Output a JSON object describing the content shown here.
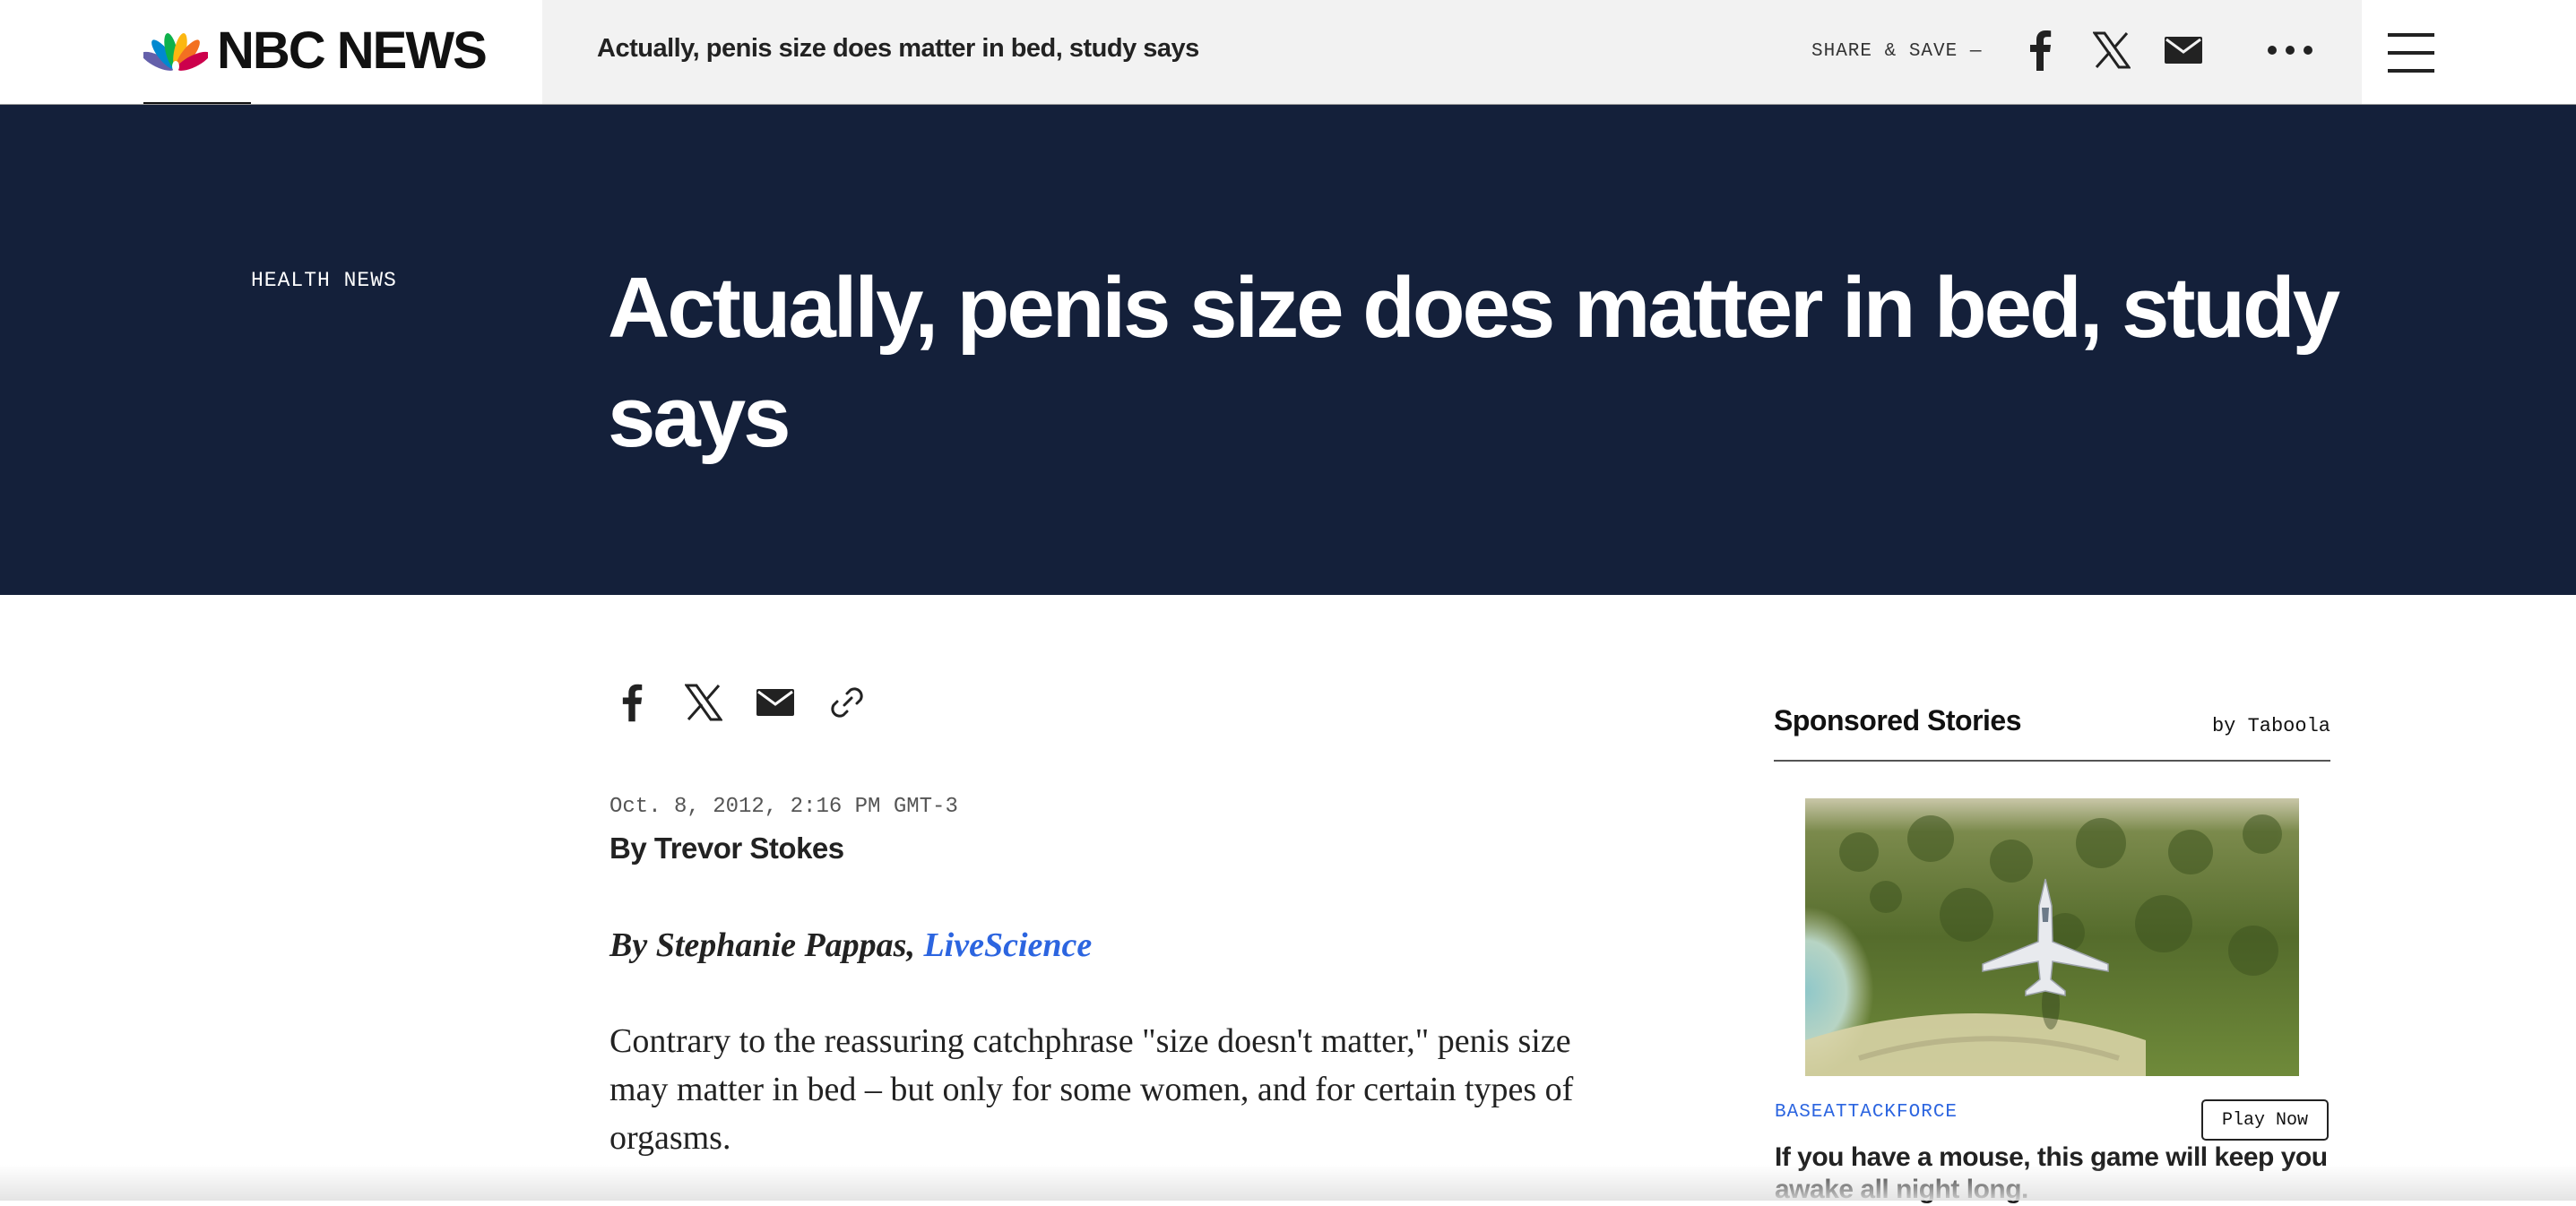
{
  "header": {
    "logo_text": "NBC NEWS",
    "sticky_title": "Actually, penis size does matter in bed, study says",
    "share_save_label": "SHARE & SAVE —",
    "icons": [
      "facebook-icon",
      "x-icon",
      "email-icon",
      "more-icon",
      "menu-icon"
    ]
  },
  "hero": {
    "section_label": "HEALTH NEWS",
    "headline": "Actually, penis size does matter in bed, study says",
    "background_color": "#14203a"
  },
  "article": {
    "share_icons": [
      "facebook-icon",
      "x-icon",
      "email-icon",
      "link-icon"
    ],
    "dateline": "Oct. 8, 2012, 2:16 PM GMT-3",
    "byline_prefix": "By",
    "author": "Trevor Stokes",
    "intro_prefix": "By Stephanie Pappas,",
    "intro_link": "LiveScience",
    "body": "Contrary to the reassuring catchphrase \"size doesn't matter,\" penis size may matter in bed – but only for some women, and for certain types of orgasms.",
    "link_color": "#2c65e0"
  },
  "sponsored": {
    "title": "Sponsored Stories",
    "by_label": "by Taboola",
    "source": "BASEATTACKFORCE",
    "button_label": "Play Now",
    "headline": "If you have a mouse, this game will keep you awake all night long."
  }
}
